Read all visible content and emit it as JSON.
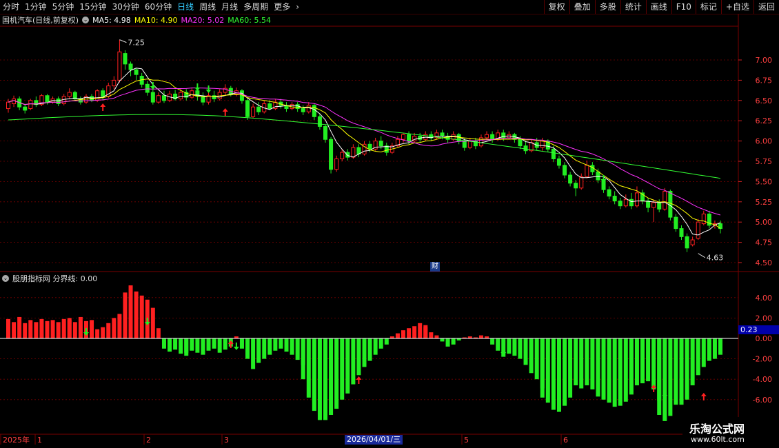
{
  "tabs": [
    "分时",
    "1分钟",
    "5分钟",
    "15分钟",
    "30分钟",
    "60分钟",
    "日线",
    "周线",
    "月线",
    "多周期",
    "更多"
  ],
  "active_tab": "日线",
  "tools": [
    "复权",
    "叠加",
    "多股",
    "统计",
    "画线",
    "F10",
    "标记",
    "+自选",
    "返回"
  ],
  "stock_title": "国机汽车(日线,前复权)",
  "ma": [
    {
      "label": "MA5: 4.98",
      "color": "#ffffff"
    },
    {
      "label": "MA10: 4.90",
      "color": "#ffff00"
    },
    {
      "label": "MA20: 5.02",
      "color": "#ff33ff"
    },
    {
      "label": "MA60: 5.54",
      "color": "#33ff33"
    }
  ],
  "indicator_title": "股朋指标网 分界线: 0.00",
  "high_label": "7.25",
  "low_label": "4.63",
  "fin_label": "财",
  "current_value": "0.23",
  "date_label": "2026/04/01/三",
  "x_labels": [
    "2025年",
    "1",
    "2",
    "3",
    "5",
    "6"
  ],
  "price_ticks": [
    "7.00",
    "6.75",
    "6.50",
    "6.25",
    "6.00",
    "5.75",
    "5.50",
    "5.25",
    "5.00",
    "4.75",
    "4.50"
  ],
  "indicator_ticks": [
    "4.00",
    "2.00",
    "0.00",
    "-2.00",
    "-4.00",
    "-6.00"
  ],
  "watermark": {
    "title": "乐淘公式网",
    "url": "www.60lt.com"
  },
  "colors": {
    "up": "#ff2020",
    "down": "#22ee22",
    "ma5": "#ffffff",
    "ma10": "#ffff00",
    "ma20": "#ff33ff",
    "ma60": "#33ff33",
    "grid": "#7a0000"
  },
  "chart_data": {
    "type": "candlestick",
    "price_range": [
      4.5,
      7.25
    ],
    "indicator_range": [
      -8,
      5.5
    ],
    "candles": [
      {
        "o": 6.4,
        "c": 6.48,
        "h": 6.52,
        "l": 6.35
      },
      {
        "o": 6.46,
        "c": 6.52,
        "h": 6.56,
        "l": 6.42
      },
      {
        "o": 6.52,
        "c": 6.42,
        "h": 6.55,
        "l": 6.38
      },
      {
        "o": 6.42,
        "c": 6.38,
        "h": 6.46,
        "l": 6.34
      },
      {
        "o": 6.4,
        "c": 6.5,
        "h": 6.52,
        "l": 6.38
      },
      {
        "o": 6.5,
        "c": 6.45,
        "h": 6.55,
        "l": 6.42
      },
      {
        "o": 6.45,
        "c": 6.56,
        "h": 6.58,
        "l": 6.43
      },
      {
        "o": 6.56,
        "c": 6.48,
        "h": 6.58,
        "l": 6.45
      },
      {
        "o": 6.48,
        "c": 6.52,
        "h": 6.55,
        "l": 6.46
      },
      {
        "o": 6.52,
        "c": 6.46,
        "h": 6.55,
        "l": 6.43
      },
      {
        "o": 6.46,
        "c": 6.55,
        "h": 6.58,
        "l": 6.44
      },
      {
        "o": 6.55,
        "c": 6.6,
        "h": 6.65,
        "l": 6.52
      },
      {
        "o": 6.6,
        "c": 6.52,
        "h": 6.62,
        "l": 6.5
      },
      {
        "o": 6.52,
        "c": 6.48,
        "h": 6.55,
        "l": 6.45
      },
      {
        "o": 6.48,
        "c": 6.55,
        "h": 6.58,
        "l": 6.46
      },
      {
        "o": 6.55,
        "c": 6.5,
        "h": 6.58,
        "l": 6.48
      },
      {
        "o": 6.5,
        "c": 6.62,
        "h": 6.64,
        "l": 6.48
      },
      {
        "o": 6.62,
        "c": 6.55,
        "h": 6.65,
        "l": 6.5
      },
      {
        "o": 6.55,
        "c": 6.68,
        "h": 6.72,
        "l": 6.53
      },
      {
        "o": 6.68,
        "c": 6.75,
        "h": 6.8,
        "l": 6.64
      },
      {
        "o": 6.75,
        "c": 7.1,
        "h": 7.25,
        "l": 6.72
      },
      {
        "o": 7.08,
        "c": 6.95,
        "h": 7.12,
        "l": 6.88
      },
      {
        "o": 6.95,
        "c": 6.88,
        "h": 6.98,
        "l": 6.8
      },
      {
        "o": 6.88,
        "c": 6.82,
        "h": 6.9,
        "l": 6.75
      },
      {
        "o": 6.8,
        "c": 6.7,
        "h": 6.84,
        "l": 6.66
      },
      {
        "o": 6.7,
        "c": 6.6,
        "h": 6.74,
        "l": 6.56
      },
      {
        "o": 6.6,
        "c": 6.48,
        "h": 6.64,
        "l": 6.45
      },
      {
        "o": 6.48,
        "c": 6.56,
        "h": 6.6,
        "l": 6.46
      },
      {
        "o": 6.56,
        "c": 6.5,
        "h": 6.62,
        "l": 6.47
      },
      {
        "o": 6.5,
        "c": 6.58,
        "h": 6.62,
        "l": 6.48
      },
      {
        "o": 6.58,
        "c": 6.52,
        "h": 6.63,
        "l": 6.5
      },
      {
        "o": 6.52,
        "c": 6.6,
        "h": 6.65,
        "l": 6.5
      },
      {
        "o": 6.6,
        "c": 6.54,
        "h": 6.64,
        "l": 6.5
      },
      {
        "o": 6.54,
        "c": 6.62,
        "h": 6.66,
        "l": 6.52
      },
      {
        "o": 6.62,
        "c": 6.55,
        "h": 6.68,
        "l": 6.5
      },
      {
        "o": 6.55,
        "c": 6.48,
        "h": 6.6,
        "l": 6.44
      },
      {
        "o": 6.48,
        "c": 6.56,
        "h": 6.6,
        "l": 6.45
      },
      {
        "o": 6.56,
        "c": 6.52,
        "h": 6.62,
        "l": 6.48
      },
      {
        "o": 6.52,
        "c": 6.6,
        "h": 6.64,
        "l": 6.5
      },
      {
        "o": 6.6,
        "c": 6.65,
        "h": 6.7,
        "l": 6.56
      },
      {
        "o": 6.65,
        "c": 6.58,
        "h": 6.68,
        "l": 6.55
      },
      {
        "o": 6.58,
        "c": 6.62,
        "h": 6.66,
        "l": 6.55
      },
      {
        "o": 6.62,
        "c": 6.5,
        "h": 6.64,
        "l": 6.46
      },
      {
        "o": 6.5,
        "c": 6.3,
        "h": 6.52,
        "l": 6.26
      },
      {
        "o": 6.3,
        "c": 6.42,
        "h": 6.46,
        "l": 6.28
      },
      {
        "o": 6.42,
        "c": 6.36,
        "h": 6.48,
        "l": 6.32
      },
      {
        "o": 6.36,
        "c": 6.46,
        "h": 6.5,
        "l": 6.34
      },
      {
        "o": 6.46,
        "c": 6.4,
        "h": 6.5,
        "l": 6.38
      },
      {
        "o": 6.4,
        "c": 6.48,
        "h": 6.52,
        "l": 6.38
      },
      {
        "o": 6.48,
        "c": 6.44,
        "h": 6.52,
        "l": 6.4
      },
      {
        "o": 6.44,
        "c": 6.4,
        "h": 6.48,
        "l": 6.36
      },
      {
        "o": 6.4,
        "c": 6.45,
        "h": 6.48,
        "l": 6.38
      },
      {
        "o": 6.45,
        "c": 6.4,
        "h": 6.48,
        "l": 6.36
      },
      {
        "o": 6.4,
        "c": 6.36,
        "h": 6.44,
        "l": 6.32
      },
      {
        "o": 6.36,
        "c": 6.44,
        "h": 6.48,
        "l": 6.34
      },
      {
        "o": 6.44,
        "c": 6.3,
        "h": 6.46,
        "l": 6.26
      },
      {
        "o": 6.3,
        "c": 6.18,
        "h": 6.34,
        "l": 6.14
      },
      {
        "o": 6.18,
        "c": 6.02,
        "h": 6.2,
        "l": 5.98
      },
      {
        "o": 6.02,
        "c": 5.65,
        "h": 6.05,
        "l": 5.6
      },
      {
        "o": 5.65,
        "c": 5.78,
        "h": 5.82,
        "l": 5.62
      },
      {
        "o": 5.78,
        "c": 5.86,
        "h": 5.9,
        "l": 5.75
      },
      {
        "o": 5.86,
        "c": 5.8,
        "h": 5.9,
        "l": 5.76
      },
      {
        "o": 5.8,
        "c": 5.92,
        "h": 5.96,
        "l": 5.78
      },
      {
        "o": 5.92,
        "c": 5.84,
        "h": 5.96,
        "l": 5.8
      },
      {
        "o": 5.84,
        "c": 5.96,
        "h": 6.0,
        "l": 5.82
      },
      {
        "o": 5.96,
        "c": 5.9,
        "h": 6.0,
        "l": 5.86
      },
      {
        "o": 5.9,
        "c": 6.0,
        "h": 6.04,
        "l": 5.88
      },
      {
        "o": 6.0,
        "c": 5.94,
        "h": 6.06,
        "l": 5.9
      },
      {
        "o": 5.94,
        "c": 5.86,
        "h": 5.98,
        "l": 5.82
      },
      {
        "o": 5.86,
        "c": 5.94,
        "h": 5.98,
        "l": 5.84
      },
      {
        "o": 5.94,
        "c": 6.02,
        "h": 6.06,
        "l": 5.92
      },
      {
        "o": 6.02,
        "c": 6.08,
        "h": 6.1,
        "l": 5.98
      },
      {
        "o": 6.08,
        "c": 6.0,
        "h": 6.12,
        "l": 5.96
      },
      {
        "o": 6.0,
        "c": 6.06,
        "h": 6.1,
        "l": 5.98
      },
      {
        "o": 6.06,
        "c": 6.02,
        "h": 6.1,
        "l": 5.98
      },
      {
        "o": 6.02,
        "c": 6.08,
        "h": 6.12,
        "l": 6.0
      },
      {
        "o": 6.08,
        "c": 6.04,
        "h": 6.12,
        "l": 6.0
      },
      {
        "o": 6.04,
        "c": 6.1,
        "h": 6.14,
        "l": 6.02
      },
      {
        "o": 6.1,
        "c": 6.06,
        "h": 6.14,
        "l": 6.02
      },
      {
        "o": 6.06,
        "c": 6.02,
        "h": 6.1,
        "l": 5.98
      },
      {
        "o": 6.02,
        "c": 6.08,
        "h": 6.12,
        "l": 6.0
      },
      {
        "o": 6.08,
        "c": 6.0,
        "h": 6.1,
        "l": 5.96
      },
      {
        "o": 6.0,
        "c": 5.92,
        "h": 6.04,
        "l": 5.88
      },
      {
        "o": 5.92,
        "c": 6.0,
        "h": 6.04,
        "l": 5.9
      },
      {
        "o": 6.0,
        "c": 5.94,
        "h": 6.04,
        "l": 5.9
      },
      {
        "o": 5.94,
        "c": 6.04,
        "h": 6.08,
        "l": 5.92
      },
      {
        "o": 6.04,
        "c": 6.08,
        "h": 6.12,
        "l": 6.02
      },
      {
        "o": 6.08,
        "c": 6.02,
        "h": 6.12,
        "l": 5.98
      },
      {
        "o": 6.02,
        "c": 6.1,
        "h": 6.14,
        "l": 6.0
      },
      {
        "o": 6.1,
        "c": 6.04,
        "h": 6.14,
        "l": 6.0
      },
      {
        "o": 6.04,
        "c": 6.08,
        "h": 6.12,
        "l": 6.02
      },
      {
        "o": 6.08,
        "c": 6.02,
        "h": 6.1,
        "l": 5.98
      },
      {
        "o": 6.02,
        "c": 5.94,
        "h": 6.06,
        "l": 5.9
      },
      {
        "o": 5.94,
        "c": 5.88,
        "h": 6.0,
        "l": 5.84
      },
      {
        "o": 5.88,
        "c": 5.98,
        "h": 6.02,
        "l": 5.86
      },
      {
        "o": 5.98,
        "c": 5.92,
        "h": 6.04,
        "l": 5.88
      },
      {
        "o": 5.92,
        "c": 6.0,
        "h": 6.04,
        "l": 5.88
      },
      {
        "o": 6.0,
        "c": 5.9,
        "h": 6.02,
        "l": 5.86
      },
      {
        "o": 5.9,
        "c": 5.78,
        "h": 5.94,
        "l": 5.74
      },
      {
        "o": 5.78,
        "c": 5.7,
        "h": 5.82,
        "l": 5.66
      },
      {
        "o": 5.7,
        "c": 5.58,
        "h": 5.74,
        "l": 5.54
      },
      {
        "o": 5.58,
        "c": 5.48,
        "h": 5.62,
        "l": 5.44
      },
      {
        "o": 5.48,
        "c": 5.42,
        "h": 5.52,
        "l": 5.32
      },
      {
        "o": 5.42,
        "c": 5.56,
        "h": 5.6,
        "l": 5.4
      },
      {
        "o": 5.56,
        "c": 5.7,
        "h": 5.76,
        "l": 5.54
      },
      {
        "o": 5.7,
        "c": 5.62,
        "h": 5.74,
        "l": 5.58
      },
      {
        "o": 5.62,
        "c": 5.52,
        "h": 5.66,
        "l": 5.48
      },
      {
        "o": 5.52,
        "c": 5.4,
        "h": 5.56,
        "l": 5.36
      },
      {
        "o": 5.4,
        "c": 5.32,
        "h": 5.44,
        "l": 5.28
      },
      {
        "o": 5.32,
        "c": 5.26,
        "h": 5.38,
        "l": 5.22
      },
      {
        "o": 5.26,
        "c": 5.2,
        "h": 5.3,
        "l": 5.16
      },
      {
        "o": 5.2,
        "c": 5.28,
        "h": 5.34,
        "l": 5.18
      },
      {
        "o": 5.28,
        "c": 5.2,
        "h": 5.36,
        "l": 5.16
      },
      {
        "o": 5.2,
        "c": 5.36,
        "h": 5.44,
        "l": 5.18
      },
      {
        "o": 5.36,
        "c": 5.26,
        "h": 5.4,
        "l": 5.22
      },
      {
        "o": 5.26,
        "c": 5.18,
        "h": 5.3,
        "l": 5.12
      },
      {
        "o": 5.18,
        "c": 5.24,
        "h": 5.28,
        "l": 5.0
      },
      {
        "o": 5.24,
        "c": 5.16,
        "h": 5.28,
        "l": 5.12
      },
      {
        "o": 5.16,
        "c": 5.38,
        "h": 5.42,
        "l": 5.14
      },
      {
        "o": 5.38,
        "c": 5.06,
        "h": 5.4,
        "l": 5.02
      },
      {
        "o": 5.06,
        "c": 4.92,
        "h": 5.1,
        "l": 4.88
      },
      {
        "o": 4.92,
        "c": 4.82,
        "h": 4.96,
        "l": 4.78
      },
      {
        "o": 4.82,
        "c": 4.68,
        "h": 4.86,
        "l": 4.63
      },
      {
        "o": 4.72,
        "c": 4.78,
        "h": 4.82,
        "l": 4.7
      },
      {
        "o": 4.8,
        "c": 5.0,
        "h": 5.04,
        "l": 4.78
      },
      {
        "o": 4.98,
        "c": 5.1,
        "h": 5.14,
        "l": 4.96
      },
      {
        "o": 5.1,
        "c": 4.96,
        "h": 5.14,
        "l": 4.92
      },
      {
        "o": 4.96,
        "c": 4.98,
        "h": 5.02,
        "l": 4.92
      },
      {
        "o": 4.98,
        "c": 4.92,
        "h": 5.02,
        "l": 4.86
      }
    ],
    "ma60_range": [
      6.26,
      5.54
    ],
    "indicator": [
      1.9,
      1.6,
      2.1,
      1.5,
      1.8,
      1.6,
      1.9,
      1.7,
      1.8,
      1.6,
      1.9,
      2.0,
      1.8,
      1.6,
      2.1,
      1.7,
      1.8,
      0.9,
      1.1,
      1.5,
      2.0,
      2.4,
      4.5,
      5.2,
      4.6,
      4.2,
      3.8,
      3.0,
      1.0,
      -1.0,
      -1.3,
      -1.1,
      -1.5,
      -1.4,
      -1.7,
      -1.2,
      -1.4,
      -1.6,
      -1.2,
      -1.0,
      -1.4,
      -1.1,
      -0.8,
      0.2,
      -1.0,
      -2.0,
      -3.0,
      -2.4,
      -2.0,
      -1.6,
      -1.2,
      -1.0,
      -1.3,
      -1.6,
      -2.1,
      -2.6,
      -4.0,
      -5.8,
      -7.1,
      -8.0,
      -8.0,
      -7.5,
      -6.9,
      -6.0,
      -5.4,
      -4.5,
      -3.6,
      -2.8,
      -2.2,
      -1.6,
      -1.0,
      -0.6,
      0.2,
      0.5,
      0.8,
      1.0,
      1.2,
      1.5,
      1.3,
      1.1,
      0.6,
      0.3,
      -0.3,
      -0.8,
      -0.6,
      -0.2,
      0.1,
      0.2,
      0.1,
      0.3,
      0.2,
      -0.6,
      -1.2,
      -1.8,
      -1.5,
      -1.7,
      -2.0,
      -2.6,
      -3.4,
      -4.0,
      -4.9,
      -5.8,
      -6.3,
      -7.0,
      -7.2,
      -6.6,
      -5.8,
      -4.6,
      -4.9,
      -4.6,
      -5.0,
      -5.7,
      -6.0,
      -6.3,
      -6.7,
      -6.6,
      -6.2,
      -5.5,
      -4.6,
      -4.4,
      -4.2,
      -5.0,
      -6.1,
      -7.5,
      -8.1,
      -7.6,
      -6.5,
      -6.5,
      -6.0,
      -4.6,
      -3.6,
      -2.8,
      -2.2,
      -2.0,
      -1.6
    ]
  }
}
